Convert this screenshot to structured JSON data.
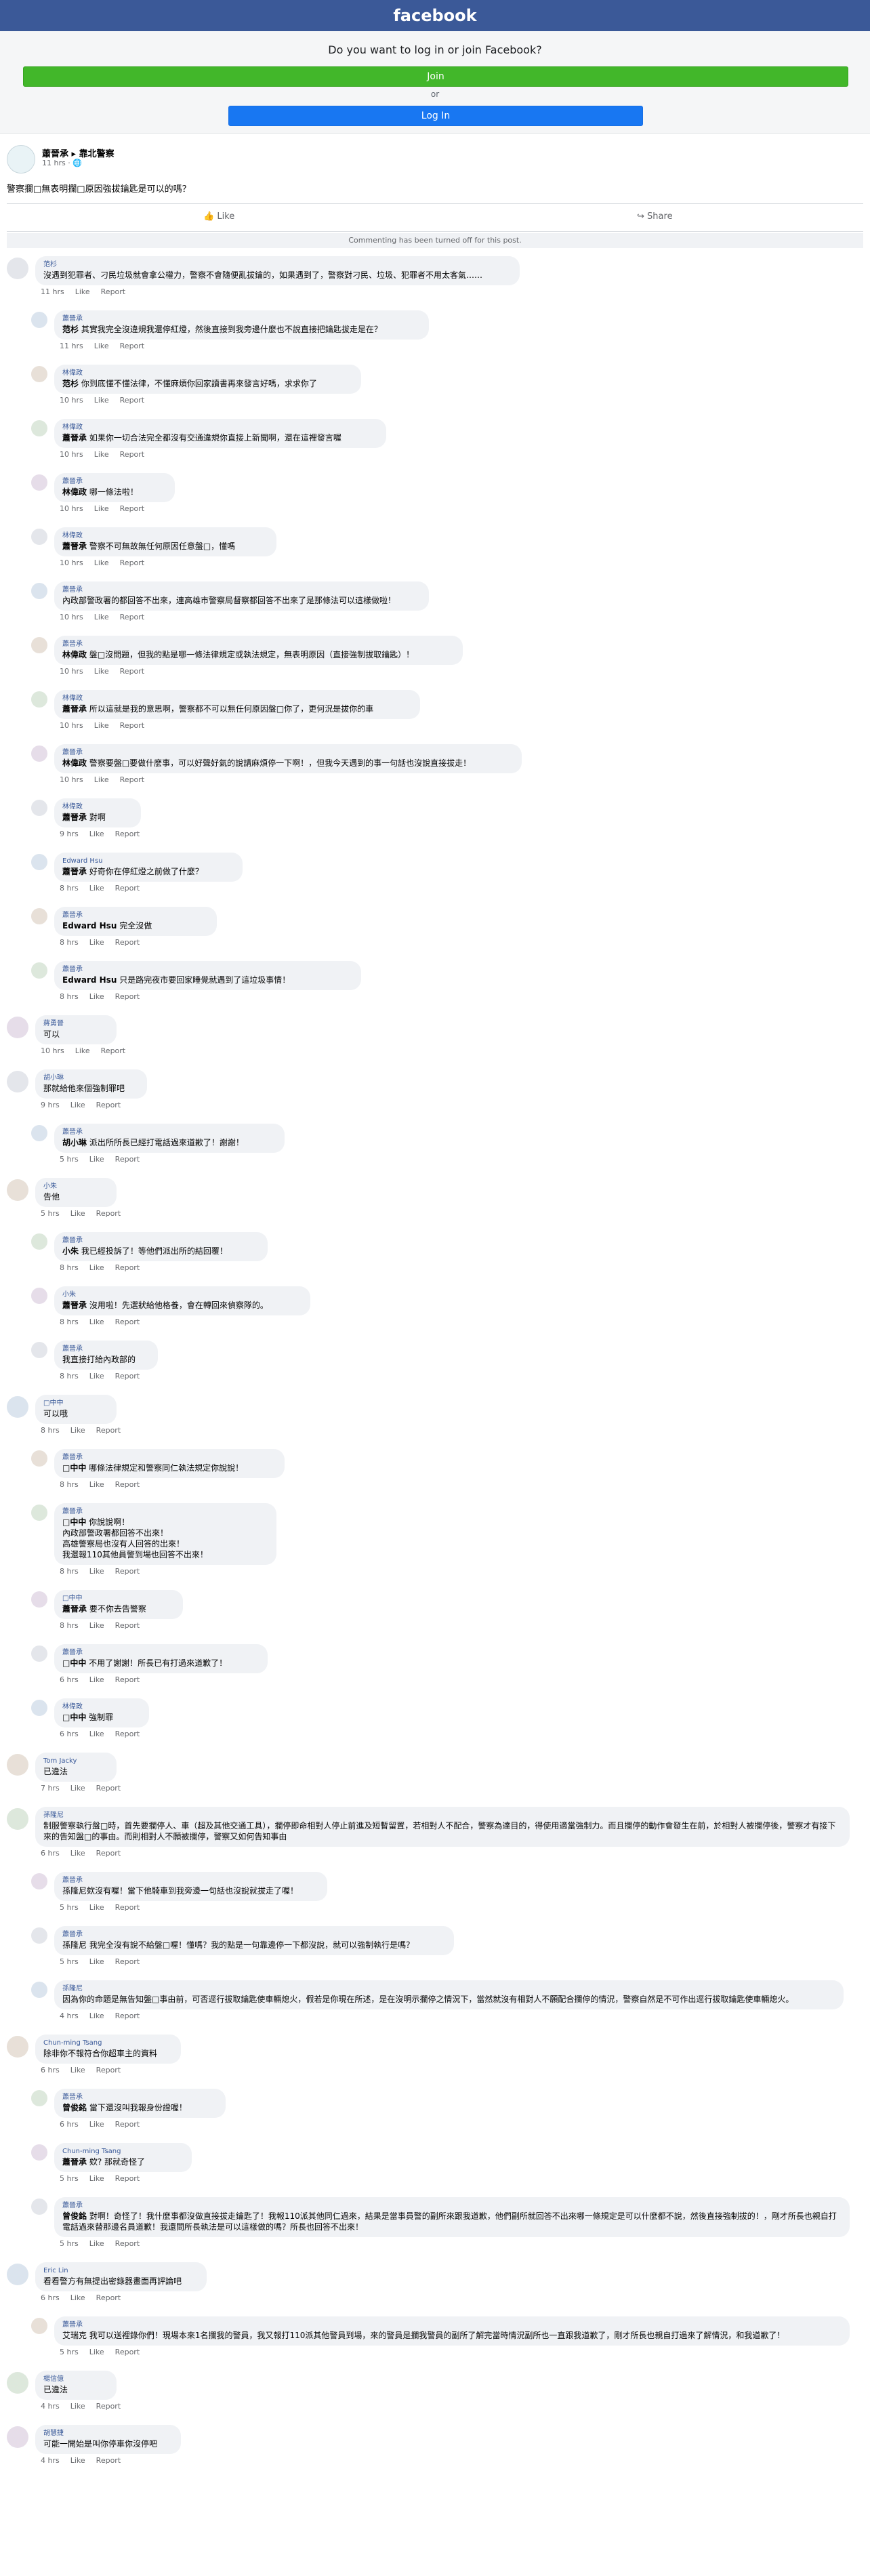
{
  "header": {
    "brand": "facebook",
    "brand_color": "#3b5998"
  },
  "login_prompt": {
    "question": "Do you want to log in or join Facebook?",
    "join_label": "Join",
    "or_label": "or",
    "login_label": "Log In"
  },
  "post": {
    "author": "蕭晉承 ▸ 靠北警察",
    "meta": "11 hrs · 🌐",
    "text": "警察攔□無表明攔□原因強拔鑰匙是可以的嗎？",
    "like_label": "Like",
    "share_label": "Share",
    "comment_notice": "Commenting has been turned off for this post."
  },
  "comments": [
    {
      "name": "范杉",
      "tag": "",
      "text": "沒遇到犯罪者、刁民垃圾就會拿公權力，警察不會隨便亂拔鑰的，如果遇到了，警察對刁民、垃圾、犯罪者不用太客氣……",
      "time": "11 hrs",
      "like": "Like",
      "report": "Report",
      "reply": false
    },
    {
      "name": "蕭晉承",
      "tag": "范杉",
      "text": " 其實我完全沒違規我還停紅燈，然後直接到我旁邊什麼也不說直接把鑰匙拔走是在？",
      "time": "11 hrs",
      "like": "Like",
      "report": "Report",
      "reply": true
    },
    {
      "name": "林偉政",
      "tag": "范杉",
      "text": " 你到底懂不懂法律，不懂麻煩你回家讀書再來發言好嗎，求求你了",
      "time": "10 hrs",
      "like": "Like",
      "report": "Report",
      "reply": true
    },
    {
      "name": "林偉政",
      "tag": "蕭晉承",
      "text": " 如果你一切合法完全都沒有交通違規你直接上新聞啊，還在這裡發言喔",
      "time": "10 hrs",
      "like": "Like",
      "report": "Report",
      "reply": true
    },
    {
      "name": "蕭晉承",
      "tag": "林偉政",
      "text": " 哪一條法啦！",
      "time": "10 hrs",
      "like": "Like",
      "report": "Report",
      "reply": true
    },
    {
      "name": "林偉政",
      "tag": "蕭晉承",
      "text": " 警察不可無故無任何原因任意盤□，懂嗎",
      "time": "10 hrs",
      "like": "Like",
      "report": "Report",
      "reply": true
    },
    {
      "name": "蕭晉承",
      "tag": "",
      "text": "內政部警政署的都回答不出來，連高雄市警察局督察都回答不出來了是那條法可以這樣做啦！",
      "time": "10 hrs",
      "like": "Like",
      "report": "Report",
      "reply": true
    },
    {
      "name": "蕭晉承",
      "tag": "林偉政",
      "text": " 盤□沒問題，但我的點是哪一條法律規定或執法規定，無表明原因（直接強制拔取鑰匙）！",
      "time": "10 hrs",
      "like": "Like",
      "report": "Report",
      "reply": true
    },
    {
      "name": "林偉政",
      "tag": "蕭晉承",
      "text": " 所以這就是我的意思啊，警察都不可以無任何原因盤□你了，更何況是拔你的車",
      "time": "10 hrs",
      "like": "Like",
      "report": "Report",
      "reply": true
    },
    {
      "name": "蕭晉承",
      "tag": "林偉政",
      "text": " 警察要盤□要做什麼事，可以好聲好氣的說請麻煩停一下啊！，但我今天遇到的事一句話也沒說直接拔走！",
      "time": "10 hrs",
      "like": "Like",
      "report": "Report",
      "reply": true
    },
    {
      "name": "林偉政",
      "tag": "蕭晉承",
      "text": " 對啊",
      "time": "9 hrs",
      "like": "Like",
      "report": "Report",
      "reply": true
    },
    {
      "name": "Edward Hsu",
      "tag": "蕭晉承",
      "text": " 好奇你在停紅燈之前做了什麼？",
      "time": "8 hrs",
      "like": "Like",
      "report": "Report",
      "reply": true
    },
    {
      "name": "蕭晉承",
      "tag": "Edward Hsu",
      "text": " 完全沒做",
      "time": "8 hrs",
      "like": "Like",
      "report": "Report",
      "reply": true
    },
    {
      "name": "蕭晉承",
      "tag": "Edward Hsu",
      "text": " 只是路完夜市要回家睡覺就遇到了這垃圾事情！",
      "time": "8 hrs",
      "like": "Like",
      "report": "Report",
      "reply": true
    },
    {
      "name": "蔣勇晉",
      "tag": "",
      "text": "可以",
      "time": "10 hrs",
      "like": "Like",
      "report": "Report",
      "reply": false
    },
    {
      "name": "胡小琳",
      "tag": "",
      "text": "那就給他來個強制罪吧",
      "time": "9 hrs",
      "like": "Like",
      "report": "Report",
      "reply": false
    },
    {
      "name": "蕭晉承",
      "tag": "胡小琳",
      "text": " 派出所所長已經打電話過來道歉了！謝謝！",
      "time": "5 hrs",
      "like": "Like",
      "report": "Report",
      "reply": true
    },
    {
      "name": "小朱",
      "tag": "",
      "text": "告他",
      "time": "5 hrs",
      "like": "Like",
      "report": "Report",
      "reply": false
    },
    {
      "name": "蕭晉承",
      "tag": "小朱",
      "text": " 我已經投訴了！等他們派出所的結回覆！",
      "time": "8 hrs",
      "like": "Like",
      "report": "Report",
      "reply": true
    },
    {
      "name": "小朱",
      "tag": "蕭晉承",
      "text": " 沒用啦！先選狀給他格養，會在轉回來偵察隊的。",
      "time": "8 hrs",
      "like": "Like",
      "report": "Report",
      "reply": true
    },
    {
      "name": "蕭晉承",
      "tag": "",
      "text": "我直接打給內政部的",
      "time": "8 hrs",
      "like": "Like",
      "report": "Report",
      "reply": true
    },
    {
      "name": "□中中",
      "tag": "",
      "text": "可以哦",
      "time": "8 hrs",
      "like": "Like",
      "report": "Report",
      "reply": false
    },
    {
      "name": "蕭晉承",
      "tag": "□中中",
      "text": " 哪條法律規定和警察同仁執法規定你說說！",
      "time": "8 hrs",
      "like": "Like",
      "report": "Report",
      "reply": true
    },
    {
      "name": "蕭晉承",
      "tag": "□中中",
      "text": " 你說說啊！\n內政部警政署都回答不出來！\n高雄警察局也沒有人回答的出來！\n我還報110其他員警到場也回答不出來！",
      "time": "8 hrs",
      "like": "Like",
      "report": "Report",
      "reply": true
    },
    {
      "name": "□中中",
      "tag": "蕭晉承",
      "text": " 要不你去告警察",
      "time": "8 hrs",
      "like": "Like",
      "report": "Report",
      "reply": true
    },
    {
      "name": "蕭晉承",
      "tag": "□中中",
      "text": " 不用了謝謝！所長已有打過來道歉了！",
      "time": "6 hrs",
      "like": "Like",
      "report": "Report",
      "reply": true
    },
    {
      "name": "林偉政",
      "tag": "□中中",
      "text": " 強制罪",
      "time": "6 hrs",
      "like": "Like",
      "report": "Report",
      "reply": true
    },
    {
      "name": "Tom Jacky",
      "tag": "",
      "text": "已違法",
      "time": "7 hrs",
      "like": "Like",
      "report": "Report",
      "reply": false
    },
    {
      "name": "孫隆尼",
      "tag": "",
      "text": "制服警察執行盤□時，首先要攔停人、車（超及其他交通工具），攔停即命相對人停止前進及短暫留置，若相對人不配合，警察為達目的，得使用適當強制力。而且攔停的動作會發生在前，於相對人被攔停後，警察才有接下來的告知盤□的事由。而則相對人不願被攔停，警察又如何告知事由",
      "time": "6 hrs",
      "like": "Like",
      "report": "Report",
      "reply": false
    },
    {
      "name": "蕭晉承",
      "tag": "",
      "text": "孫隆尼欸沒有喔！當下他騎車到我旁邊一句話也沒說就拔走了喔！",
      "time": "5 hrs",
      "like": "Like",
      "report": "Report",
      "reply": true
    },
    {
      "name": "蕭晉承",
      "tag": "",
      "text": "孫隆尼 我完全沒有說不給盤□喔！懂嗎？我的點是一句靠邊停一下都沒說，就可以強制執行是嗎？",
      "time": "5 hrs",
      "like": "Like",
      "report": "Report",
      "reply": true
    },
    {
      "name": "孫隆尼",
      "tag": "",
      "text": "因為你的命題是無告知盤□事由前，可否逕行拔取鑰匙使車輛熄火，假若是你現在所述，是在沒明示攔停之情況下，當然就沒有相對人不願配合攔停的情況，警察自然是不可作出逕行拔取鑰匙使車輛熄火。",
      "time": "4 hrs",
      "like": "Like",
      "report": "Report",
      "reply": true
    },
    {
      "name": "Chun-ming Tsang",
      "tag": "",
      "text": "除非你不報符合你超車主的資料",
      "time": "6 hrs",
      "like": "Like",
      "report": "Report",
      "reply": false
    },
    {
      "name": "蕭晉承",
      "tag": "曾俊銘",
      "text": " 當下還沒叫我報身份證喔！",
      "time": "6 hrs",
      "like": "Like",
      "report": "Report",
      "reply": true
    },
    {
      "name": "Chun-ming Tsang",
      "tag": "蕭晉承",
      "text": " 欸? 那就奇怪了",
      "time": "5 hrs",
      "like": "Like",
      "report": "Report",
      "reply": true
    },
    {
      "name": "蕭晉承",
      "tag": "曾俊銘",
      "text": " 對啊！奇怪了！我什麼事都沒做直接拔走鑰匙了！我報110派其他同仁過來，結果是當事員警的副所來跟我道歉，他們副所就回答不出來哪一條規定是可以什麼都不說，然後直接強制拔的！，剛才所長也親自打電話過來替那邊名員道歉！我還問所長執法是可以這樣做的嗎？所長也回答不出來！",
      "time": "5 hrs",
      "like": "Like",
      "report": "Report",
      "reply": true
    },
    {
      "name": "Eric Lin",
      "tag": "",
      "text": "看看警方有無提出密錄器畫面再評論吧",
      "time": "6 hrs",
      "like": "Like",
      "report": "Report",
      "reply": false
    },
    {
      "name": "蕭晉承",
      "tag": "",
      "text": "艾瑞克 我可以送裡錄你們！現場本來1名攔我的警員，我又報打110派其他警員到場，來的警員是攔我警員的副所了解完當時情況副所也一直跟我道歉了，剛才所長也親自打過來了解情況，和我道歉了！",
      "time": "5 hrs",
      "like": "Like",
      "report": "Report",
      "reply": true
    },
    {
      "name": "楊信億",
      "tag": "",
      "text": "已違法",
      "time": "4 hrs",
      "like": "Like",
      "report": "Report",
      "reply": false
    },
    {
      "name": "胡慧捷",
      "tag": "",
      "text": "可能一開始是叫你停車你沒停吧",
      "time": "4 hrs",
      "like": "Like",
      "report": "Report",
      "reply": false
    }
  ]
}
